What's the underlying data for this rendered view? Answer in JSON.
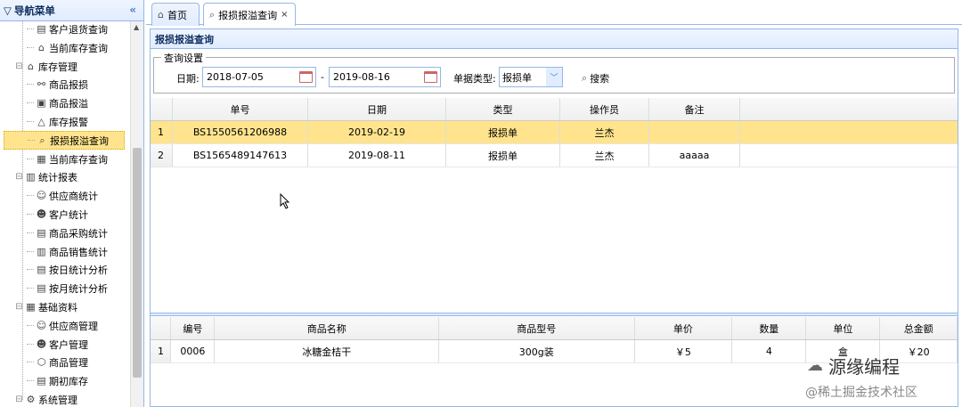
{
  "sidebar": {
    "title": "导航菜单",
    "collapse_icon": "«",
    "items": [
      {
        "label": "客户退货查询",
        "icon": "document-icon",
        "glyph": "▤",
        "level": 2
      },
      {
        "label": "当前库存查询",
        "icon": "house-icon",
        "glyph": "⌂",
        "level": 2
      },
      {
        "label": "库存管理",
        "icon": "house-icon",
        "glyph": "⌂",
        "level": 1
      },
      {
        "label": "商品报损",
        "icon": "link-icon",
        "glyph": "⚯",
        "level": 2
      },
      {
        "label": "商品报溢",
        "icon": "arrow-box-icon",
        "glyph": "▣",
        "level": 2
      },
      {
        "label": "库存报警",
        "icon": "bell-icon",
        "glyph": "△",
        "level": 2
      },
      {
        "label": "报损报溢查询",
        "icon": "search-icon",
        "glyph": "⌕",
        "level": 2,
        "selected": true
      },
      {
        "label": "当前库存查询",
        "icon": "grid-icon",
        "glyph": "▦",
        "level": 2
      },
      {
        "label": "统计报表",
        "icon": "bar-chart-icon",
        "glyph": "▥",
        "level": 1
      },
      {
        "label": "供应商统计",
        "icon": "user-icon",
        "glyph": "☺",
        "level": 2
      },
      {
        "label": "客户统计",
        "icon": "users-icon",
        "glyph": "☻",
        "level": 2
      },
      {
        "label": "商品采购统计",
        "icon": "document-icon",
        "glyph": "▤",
        "level": 2
      },
      {
        "label": "商品销售统计",
        "icon": "bar-chart-icon",
        "glyph": "▥",
        "level": 2
      },
      {
        "label": "按日统计分析",
        "icon": "document-icon",
        "glyph": "▤",
        "level": 2
      },
      {
        "label": "按月统计分析",
        "icon": "document-icon",
        "glyph": "▤",
        "level": 2
      },
      {
        "label": "基础资料",
        "icon": "book-icon",
        "glyph": "▦",
        "level": 1
      },
      {
        "label": "供应商管理",
        "icon": "user-icon",
        "glyph": "☺",
        "level": 2
      },
      {
        "label": "客户管理",
        "icon": "users-icon",
        "glyph": "☻",
        "level": 2
      },
      {
        "label": "商品管理",
        "icon": "box-icon",
        "glyph": "⬡",
        "level": 2
      },
      {
        "label": "期初库存",
        "icon": "book-icon",
        "glyph": "▤",
        "level": 2
      },
      {
        "label": "系统管理",
        "icon": "gear-icon",
        "glyph": "⚙",
        "level": 1
      }
    ]
  },
  "tabs": [
    {
      "label": "首页",
      "icon": "home-icon",
      "glyph": "⌂",
      "closable": false
    },
    {
      "label": "报损报溢查询",
      "icon": "search-icon",
      "glyph": "⌕",
      "closable": true,
      "close_glyph": "×"
    }
  ],
  "panel": {
    "title": "报损报溢查询",
    "query": {
      "legend": "查询设置",
      "date_label": "日期:",
      "date_from": "2018-07-05",
      "date_sep": "-",
      "date_to": "2019-08-16",
      "type_label": "单据类型:",
      "type_value": "报损单",
      "search_label": "搜索"
    },
    "main_grid": {
      "headers": [
        "单号",
        "日期",
        "类型",
        "操作员",
        "备注"
      ],
      "rows": [
        {
          "num": "1",
          "cells": [
            "BS1550561206988",
            "2019-02-19",
            "报损单",
            "兰杰",
            ""
          ]
        },
        {
          "num": "2",
          "cells": [
            "BS1565489147613",
            "2019-08-11",
            "报损单",
            "兰杰",
            "aaaaa"
          ]
        }
      ]
    },
    "detail_grid": {
      "headers": [
        "编号",
        "商品名称",
        "商品型号",
        "单价",
        "数量",
        "单位",
        "总金额"
      ],
      "rows": [
        {
          "num": "1",
          "cells": [
            "0006",
            "冰糖金桔干",
            "300g装",
            "￥5",
            "4",
            "盒",
            "￥20"
          ]
        }
      ]
    }
  },
  "watermark": {
    "brand": "源缘编程",
    "community": "@稀土掘金技术社区"
  },
  "colors": {
    "border": "#95b8e7",
    "header_bg": "#e0ecff",
    "selected_row": "#ffe48d"
  }
}
